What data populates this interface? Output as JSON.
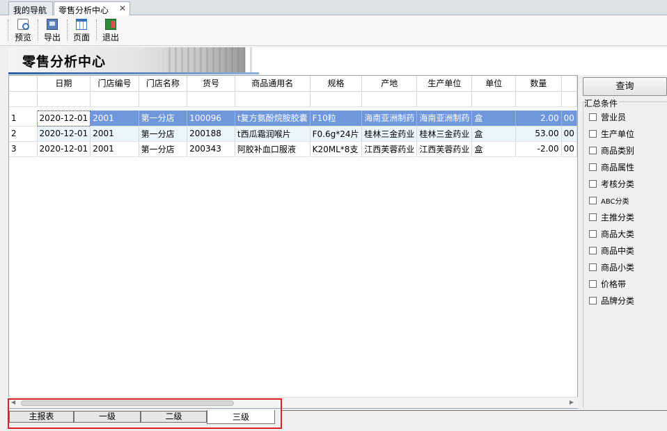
{
  "tabs": [
    {
      "label": "我的导航"
    },
    {
      "label": "零售分析中心",
      "close": "✕"
    }
  ],
  "toolbar": {
    "preview": "预览",
    "export": "导出",
    "page": "页面",
    "exit": "退出"
  },
  "banner": {
    "title": "零售分析中心"
  },
  "grid": {
    "columns": [
      "",
      "日期",
      "门店编号",
      "门店名称",
      "货号",
      "商品通用名",
      "规格",
      "产地",
      "生产单位",
      "单位",
      "数量",
      ""
    ],
    "rows": [
      [
        "1",
        "2020-12-01",
        "2001",
        "第一分店",
        "100096",
        "t复方氨酚烷胺胶囊",
        "F10粒",
        "海南亚洲制药",
        "海南亚洲制药",
        "盒",
        "2.00",
        "00"
      ],
      [
        "2",
        "2020-12-01",
        "2001",
        "第一分店",
        "200188",
        "t西瓜霜润喉片",
        "F0.6g*24片",
        "桂林三金药业",
        "桂林三金药业",
        "盒",
        "53.00",
        "00"
      ],
      [
        "3",
        "2020-12-01",
        "2001",
        "第一分店",
        "200343",
        "阿胶补血口服液",
        "K20ML*8支",
        "江西芙蓉药业",
        "江西芙蓉药业",
        "盒",
        "-2.00",
        "00"
      ]
    ]
  },
  "bottom_tabs": [
    "主报表",
    "一级",
    "二级",
    "三级"
  ],
  "right_panel": {
    "query_button": "查询",
    "group_title": "汇总条件",
    "conditions": [
      "营业员",
      "生产单位",
      "商品类别",
      "商品属性",
      "考核分类",
      "ABC分类",
      "主推分类",
      "商品大类",
      "商品中类",
      "商品小类",
      "价格带",
      "品牌分类"
    ]
  },
  "colors": {
    "selected_row": "#6f97dc",
    "alt_row": "#eaf5fc",
    "highlight_box": "#e02020"
  }
}
